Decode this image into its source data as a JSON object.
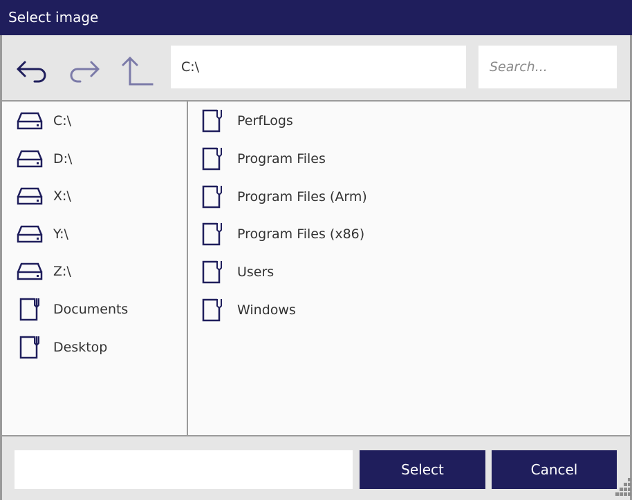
{
  "window": {
    "title": "Select image"
  },
  "toolbar": {
    "back_icon": "back-arrow-icon",
    "forward_icon": "forward-arrow-icon",
    "up_icon": "up-arrow-icon",
    "path_value": "C:\\",
    "search_placeholder": "Search...",
    "search_value": ""
  },
  "sidebar": {
    "items": [
      {
        "label": "C:\\",
        "icon": "drive-icon"
      },
      {
        "label": "D:\\",
        "icon": "drive-icon"
      },
      {
        "label": "X:\\",
        "icon": "drive-icon"
      },
      {
        "label": "Y:\\",
        "icon": "drive-icon"
      },
      {
        "label": "Z:\\",
        "icon": "drive-icon"
      },
      {
        "label": "Documents",
        "icon": "folder-icon"
      },
      {
        "label": "Desktop",
        "icon": "folder-icon"
      }
    ]
  },
  "filelist": {
    "items": [
      {
        "label": "PerfLogs",
        "icon": "folder-icon"
      },
      {
        "label": "Program Files",
        "icon": "folder-icon"
      },
      {
        "label": "Program Files (Arm)",
        "icon": "folder-icon"
      },
      {
        "label": "Program Files (x86)",
        "icon": "folder-icon"
      },
      {
        "label": "Users",
        "icon": "folder-icon"
      },
      {
        "label": "Windows",
        "icon": "folder-icon"
      }
    ]
  },
  "footer": {
    "filename_value": "",
    "select_label": "Select",
    "cancel_label": "Cancel"
  },
  "colors": {
    "accent": "#1f1e5c",
    "accent_disabled": "#7b7aa8",
    "panel_bg": "#fafafa",
    "chrome_bg": "#e6e6e6",
    "border": "#9a9a9a"
  }
}
